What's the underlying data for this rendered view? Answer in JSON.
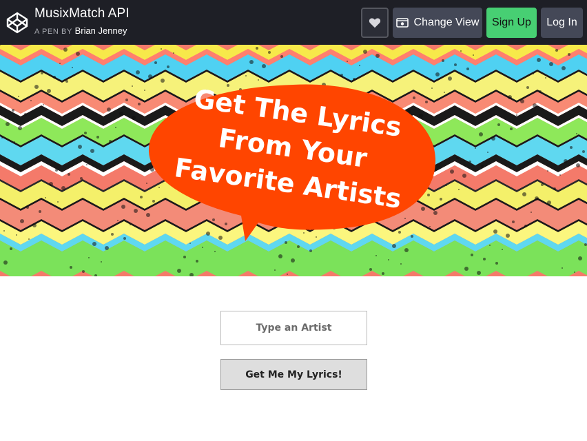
{
  "header": {
    "title": "MusixMatch API",
    "byline_prefix": "A PEN BY",
    "author": "Brian Jenney",
    "change_view_label": "Change View",
    "signup_label": "Sign Up",
    "login_label": "Log In"
  },
  "banner": {
    "headline_lines": [
      "Get The Lyrics",
      "From Your",
      "Favorite Artists"
    ],
    "bubble_color": "#ff4500"
  },
  "form": {
    "artist_placeholder": "Type an Artist",
    "artist_value": "",
    "submit_label": "Get Me My Lyrics!"
  },
  "colors": {
    "topbar": "#1e1f26",
    "signup": "#47cf73",
    "button_dark": "#444857"
  }
}
